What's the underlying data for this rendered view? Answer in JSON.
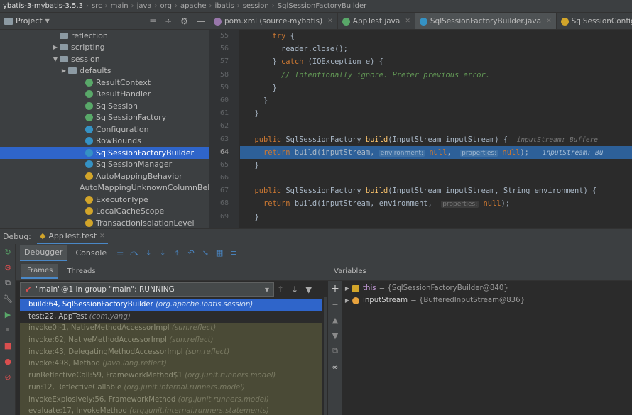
{
  "breadcrumb": [
    "ybatis-3-mybatis-3.5.3",
    "src",
    "main",
    "java",
    "org",
    "apache",
    "ibatis",
    "session",
    "SqlSessionFactoryBuilder"
  ],
  "project": {
    "title": "Project",
    "dropdown_icon": "chevron-down-icon"
  },
  "tabs": [
    {
      "label": "pom.xml (source-mybatis)",
      "icon_color": "#9876aa",
      "active": false
    },
    {
      "label": "AppTest.java",
      "icon_color": "#59a869",
      "active": false
    },
    {
      "label": "SqlSessionFactoryBuilder.java",
      "icon_color": "#3592c4",
      "active": true
    },
    {
      "label": "SqlSessionConfig.xml",
      "icon_color": "#d2a52a",
      "active": false
    }
  ],
  "tree": [
    {
      "label": "reflection",
      "kind": "folder",
      "arrow": "",
      "indent": 6
    },
    {
      "label": "scripting",
      "kind": "folder",
      "arrow": "▶",
      "indent": 6
    },
    {
      "label": "session",
      "kind": "folder",
      "arrow": "▼",
      "indent": 6
    },
    {
      "label": "defaults",
      "kind": "folder",
      "arrow": "▶",
      "indent": 7
    },
    {
      "label": "ResultContext",
      "kind": "i",
      "arrow": "",
      "indent": 9
    },
    {
      "label": "ResultHandler",
      "kind": "i",
      "arrow": "",
      "indent": 9
    },
    {
      "label": "SqlSession",
      "kind": "i",
      "arrow": "",
      "indent": 9
    },
    {
      "label": "SqlSessionFactory",
      "kind": "i",
      "arrow": "",
      "indent": 9
    },
    {
      "label": "Configuration",
      "kind": "c",
      "arrow": "",
      "indent": 9
    },
    {
      "label": "RowBounds",
      "kind": "c",
      "arrow": "",
      "indent": 9
    },
    {
      "label": "SqlSessionFactoryBuilder",
      "kind": "c",
      "arrow": "",
      "indent": 9,
      "selected": true
    },
    {
      "label": "SqlSessionManager",
      "kind": "c",
      "arrow": "",
      "indent": 9
    },
    {
      "label": "AutoMappingBehavior",
      "kind": "e",
      "arrow": "",
      "indent": 9
    },
    {
      "label": "AutoMappingUnknownColumnBeh",
      "kind": "e",
      "arrow": "",
      "indent": 9
    },
    {
      "label": "ExecutorType",
      "kind": "e",
      "arrow": "",
      "indent": 9
    },
    {
      "label": "LocalCacheScope",
      "kind": "e",
      "arrow": "",
      "indent": 9
    },
    {
      "label": "TransactionIsolationLevel",
      "kind": "e",
      "arrow": "",
      "indent": 9
    }
  ],
  "code": {
    "line_numbers": [
      "55",
      "56",
      "57",
      "58",
      "59",
      "60",
      "61",
      "62",
      "63",
      "64",
      "65",
      "66",
      "67",
      "68",
      "69"
    ],
    "current_line_index": 9,
    "lines": [
      [
        {
          "t": "      ",
          "c": ""
        },
        {
          "t": "try",
          "c": "kw"
        },
        {
          "t": " {",
          "c": ""
        }
      ],
      [
        {
          "t": "        reader.close();",
          "c": ""
        }
      ],
      [
        {
          "t": "      } ",
          "c": ""
        },
        {
          "t": "catch",
          "c": "kw"
        },
        {
          "t": " (IOException e) {",
          "c": ""
        }
      ],
      [
        {
          "t": "        // Intentionally ignore. Prefer previous error.",
          "c": "cm"
        }
      ],
      [
        {
          "t": "      }",
          "c": ""
        }
      ],
      [
        {
          "t": "    }",
          "c": ""
        }
      ],
      [
        {
          "t": "  }",
          "c": ""
        }
      ],
      [
        {
          "t": "",
          "c": ""
        }
      ],
      [
        {
          "t": "  ",
          "c": ""
        },
        {
          "t": "public",
          "c": "kw"
        },
        {
          "t": " SqlSessionFactory ",
          "c": ""
        },
        {
          "t": "build",
          "c": "fn"
        },
        {
          "t": "(InputStream inputStream) {  ",
          "c": ""
        },
        {
          "t": "inputStream: Buffere",
          "c": "inl"
        }
      ],
      [
        {
          "t": "    ",
          "c": ""
        },
        {
          "t": "return",
          "c": "kw"
        },
        {
          "t": " build(inputStream, ",
          "c": ""
        },
        {
          "t": "environment:",
          "c": "hint"
        },
        {
          "t": " ",
          "c": ""
        },
        {
          "t": "null",
          "c": "kw"
        },
        {
          "t": ",  ",
          "c": ""
        },
        {
          "t": "properties:",
          "c": "hint"
        },
        {
          "t": " ",
          "c": ""
        },
        {
          "t": "null",
          "c": "kw"
        },
        {
          "t": ");   ",
          "c": ""
        },
        {
          "t": "inputStream: Bu",
          "c": "inl"
        }
      ],
      [
        {
          "t": "  }",
          "c": ""
        }
      ],
      [
        {
          "t": "",
          "c": ""
        }
      ],
      [
        {
          "t": "  ",
          "c": ""
        },
        {
          "t": "public",
          "c": "kw"
        },
        {
          "t": " SqlSessionFactory ",
          "c": ""
        },
        {
          "t": "build",
          "c": "fn"
        },
        {
          "t": "(InputStream inputStream, String environment) {",
          "c": ""
        }
      ],
      [
        {
          "t": "    ",
          "c": ""
        },
        {
          "t": "return",
          "c": "kw"
        },
        {
          "t": " build(inputStream, environment,  ",
          "c": ""
        },
        {
          "t": "properties:",
          "c": "hint"
        },
        {
          "t": " ",
          "c": ""
        },
        {
          "t": "null",
          "c": "kw"
        },
        {
          "t": ");",
          "c": ""
        }
      ],
      [
        {
          "t": "  }",
          "c": ""
        }
      ]
    ]
  },
  "debug": {
    "label": "Debug:",
    "session": "AppTest.test",
    "tabs": [
      {
        "label": "Debugger",
        "active": true
      },
      {
        "label": "Console",
        "active": false
      }
    ],
    "frames_tabs": [
      {
        "label": "Frames",
        "active": true
      },
      {
        "label": "Threads",
        "active": false
      }
    ],
    "thread": "\"main\"@1 in group \"main\": RUNNING",
    "frames": [
      {
        "method": "build:64, SqlSessionFactoryBuilder",
        "pkg": "(org.apache.ibatis.session)",
        "type": "active"
      },
      {
        "method": "test:22, AppTest",
        "pkg": "(com.yang)",
        "type": "normal"
      },
      {
        "method": "invoke0:-1, NativeMethodAccessorImpl",
        "pkg": "(sun.reflect)",
        "type": "lib"
      },
      {
        "method": "invoke:62, NativeMethodAccessorImpl",
        "pkg": "(sun.reflect)",
        "type": "lib"
      },
      {
        "method": "invoke:43, DelegatingMethodAccessorImpl",
        "pkg": "(sun.reflect)",
        "type": "lib"
      },
      {
        "method": "invoke:498, Method",
        "pkg": "(java.lang.reflect)",
        "type": "lib"
      },
      {
        "method": "runReflectiveCall:59, FrameworkMethod$1",
        "pkg": "(org.junit.runners.model)",
        "type": "lib"
      },
      {
        "method": "run:12, ReflectiveCallable",
        "pkg": "(org.junit.internal.runners.model)",
        "type": "lib"
      },
      {
        "method": "invokeExplosively:56, FrameworkMethod",
        "pkg": "(org.junit.runners.model)",
        "type": "lib"
      },
      {
        "method": "evaluate:17, InvokeMethod",
        "pkg": "(org.junit.internal.runners.statements)",
        "type": "lib"
      }
    ],
    "variables_label": "Variables",
    "variables": [
      {
        "name": "this",
        "value": "= {SqlSessionFactoryBuilder@840}",
        "icon": "field-icon",
        "color": "#d2a52a"
      },
      {
        "name": "inputStream",
        "value": "= {BufferedInputStream@836}",
        "icon": "parameter-icon",
        "color": "#e8a33d"
      }
    ]
  }
}
